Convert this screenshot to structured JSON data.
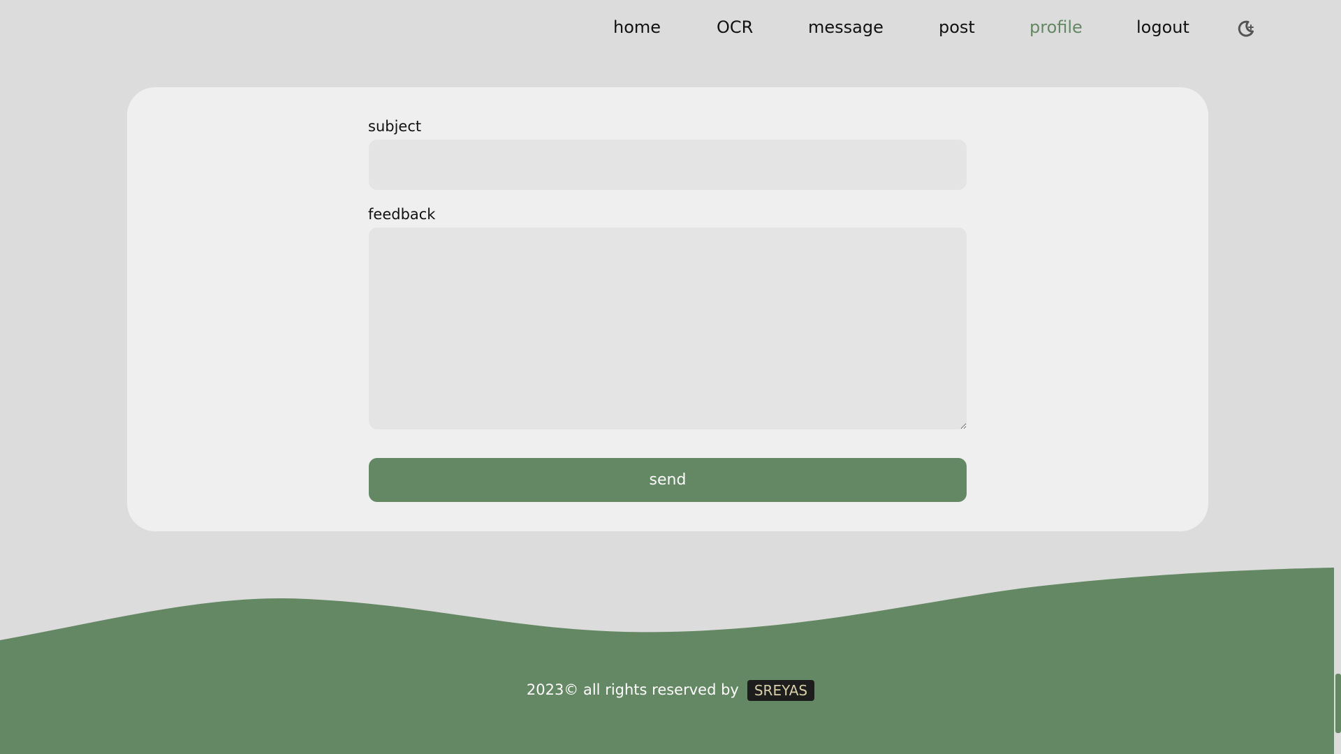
{
  "nav": {
    "items": [
      {
        "label": "home",
        "active": false
      },
      {
        "label": "OCR",
        "active": false
      },
      {
        "label": "message",
        "active": false
      },
      {
        "label": "post",
        "active": false
      },
      {
        "label": "profile",
        "active": true
      },
      {
        "label": "logout",
        "active": false
      }
    ],
    "theme_toggle_icon": "moon-icon"
  },
  "form": {
    "subject_label": "subject",
    "subject_value": "",
    "feedback_label": "feedback",
    "feedback_value": "",
    "send_label": "send"
  },
  "footer": {
    "text": "2023© all rights reserved by",
    "brand": "SREYAS"
  },
  "colors": {
    "accent": "#658864",
    "background": "#dcdcdc",
    "card": "#efefef",
    "input": "#e4e4e4",
    "badge_bg": "#1d1d1d",
    "badge_text": "#d8cfa8"
  }
}
